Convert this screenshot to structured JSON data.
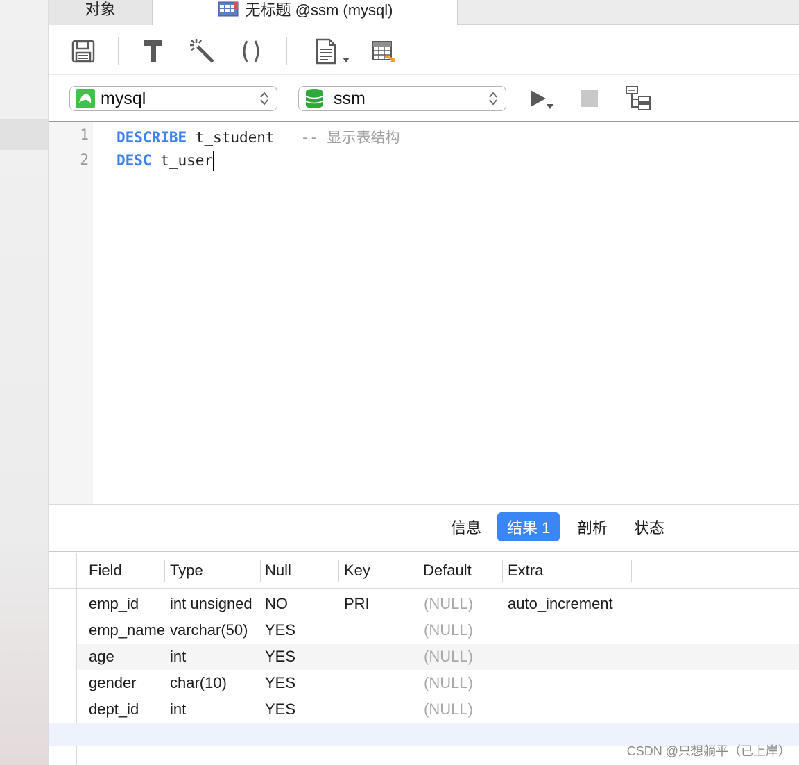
{
  "tabs": {
    "objects_label": "对象",
    "query_label": "无标题 @ssm (mysql)"
  },
  "toolbar": {
    "icons": [
      "save-icon",
      "format-icon",
      "beautify-icon",
      "parentheses-icon",
      "snippet-icon",
      "export-icon"
    ]
  },
  "connection": {
    "label": "mysql",
    "color": "#3fc34a"
  },
  "database": {
    "label": "ssm",
    "color": "#2fa83a"
  },
  "editor": {
    "lines": [
      {
        "number": "1",
        "keyword": "DESCRIBE",
        "text": " t_student   ",
        "comment": "-- 显示表结构"
      },
      {
        "number": "2",
        "keyword": "DESC",
        "text": " t_user",
        "comment": ""
      }
    ]
  },
  "result_tabs": [
    {
      "label": "信息",
      "active": false
    },
    {
      "label": "结果 1",
      "active": true
    },
    {
      "label": "剖析",
      "active": false
    },
    {
      "label": "状态",
      "active": false
    }
  ],
  "result_table": {
    "columns": [
      "Field",
      "Type",
      "Null",
      "Key",
      "Default",
      "Extra"
    ],
    "rows": [
      [
        "emp_id",
        "int unsigned",
        "NO",
        "PRI",
        "(NULL)",
        "auto_increment"
      ],
      [
        "emp_name",
        "varchar(50)",
        "YES",
        "",
        "(NULL)",
        ""
      ],
      [
        "age",
        "int",
        "YES",
        "",
        "(NULL)",
        ""
      ],
      [
        "gender",
        "char(10)",
        "YES",
        "",
        "(NULL)",
        ""
      ],
      [
        "dept_id",
        "int",
        "YES",
        "",
        "(NULL)",
        ""
      ]
    ]
  },
  "watermark": "CSDN @只想躺平（已上岸）",
  "colors": {
    "accent": "#3a86f4",
    "keyword": "#3b82f0",
    "null_text": "#a9a9a9"
  }
}
